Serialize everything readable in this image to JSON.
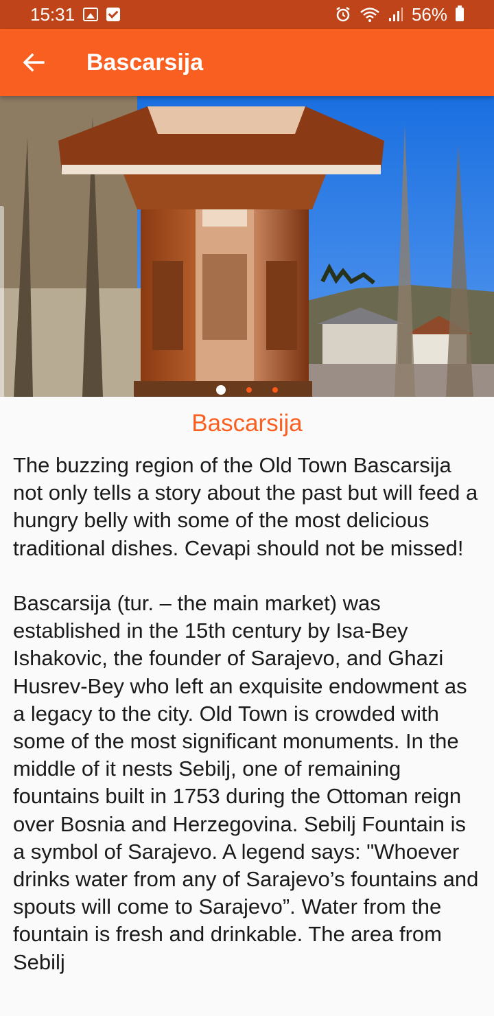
{
  "status_bar": {
    "time": "15:31",
    "battery": "56%",
    "icons": [
      "image-icon",
      "check-icon",
      "alarm-icon",
      "wifi-icon",
      "signal-icon",
      "battery-icon"
    ]
  },
  "app_bar": {
    "title": "Bascarsija",
    "back_icon": "arrow-left-icon",
    "color": "#fa5f22"
  },
  "gallery": {
    "image_count": 3,
    "active_index": 0
  },
  "place": {
    "title": "Bascarsija",
    "description": "The buzzing region of the Old Town Bascarsija not only tells a story about the past but will feed a hungry belly with some of the most delicious traditional dishes. Cevapi should not be missed!\n\nBascarsija (tur. – the main market) was established in the 15th century by Isa-Bey Ishakovic, the founder of Sarajevo, and Ghazi Husrev-Bey who left an exquisite endowment as a legacy to the city. Old Town is crowded with some of the most significant monuments. In the middle of it nests Sebilj, one of remaining fountains built in 1753 during the Ottoman reign over Bosnia and Herzegovina. Sebilj Fountain is a symbol of Sarajevo. A legend says: \"Whoever drinks water from any of Sarajevo’s fountains and spouts will come to Sarajevo”. Water from the fountain is fresh and drinkable. The area from Sebilj"
  }
}
